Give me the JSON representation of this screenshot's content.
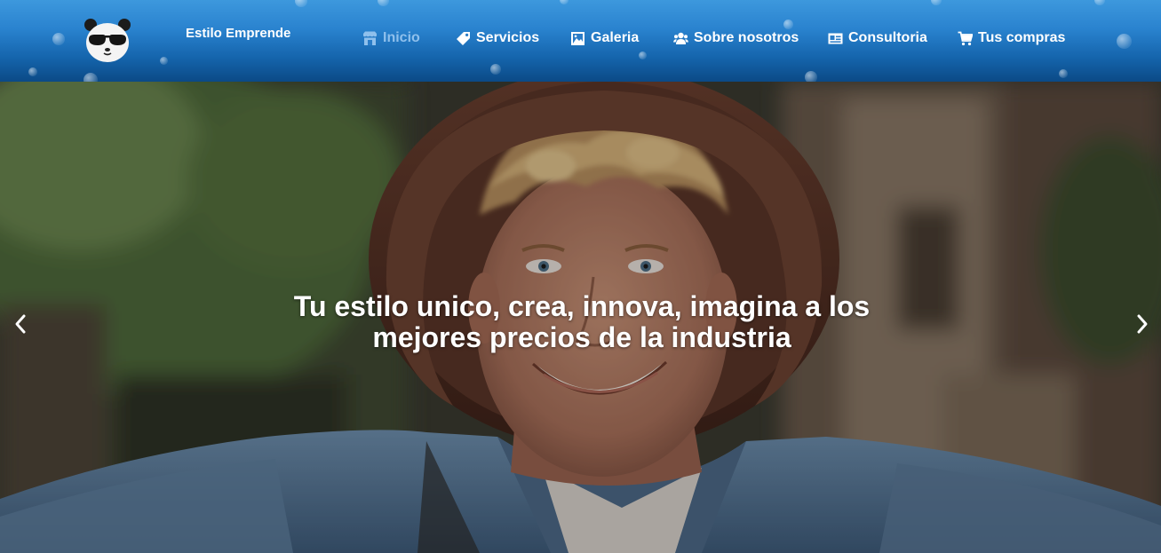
{
  "header": {
    "brand": "Estilo Emprende",
    "logo_icon": "panda-sunglasses-icon",
    "gradient_colors": [
      "#3d98dd",
      "#0b4a86"
    ],
    "active_color": "#8fc0ec"
  },
  "nav": {
    "items": [
      {
        "label": "Inicio",
        "icon": "store-icon",
        "active": true
      },
      {
        "label": "Servicios",
        "icon": "tag-icon",
        "active": false
      },
      {
        "label": "Galeria",
        "icon": "image-gallery-icon",
        "active": false
      },
      {
        "label": "Sobre nosotros",
        "icon": "users-icon",
        "active": false
      },
      {
        "label": "Consultoria",
        "icon": "id-card-icon",
        "active": false
      },
      {
        "label": "Tus compras",
        "icon": "cart-icon",
        "active": false
      }
    ]
  },
  "hero": {
    "caption_line1": "Tu estilo unico, crea, innova, imagina a los",
    "caption_line2": "mejores precios de la industria",
    "prev_icon": "chevron-left-icon",
    "next_icon": "chevron-right-icon"
  }
}
